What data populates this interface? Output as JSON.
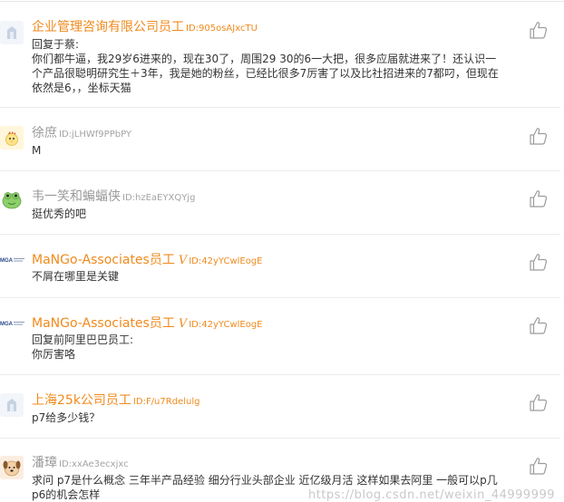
{
  "comments": [
    {
      "name": "企业管理咨询有限公司员工",
      "id_label": "ID:905osAJxcTU",
      "lines": [
        "回复于蔡:",
        "你们都牛逼，我29岁6进来的，现在30了，周围29 30的6一大把，很多应届就进来了！还认识一",
        "个产品很聪明研究生＋3年，我是她的粉丝，已经比很多7厉害了以及比社招进来的7都叼，但现在",
        "依然是6，，坐标天猫"
      ]
    },
    {
      "name": "徐庶",
      "id_label": "ID:jLHWf9PPbPY",
      "lines": [
        "M"
      ]
    },
    {
      "name": "韦一笑和蝙蝠侠",
      "id_label": "ID:hzEaEYXQYjg",
      "lines": [
        "挺优秀的吧"
      ]
    },
    {
      "name": "MaNGo-Associates员工",
      "verified": "V",
      "id_label": "ID:42yYCwlEogE",
      "logo_text": "MGA",
      "lines": [
        "不屑在哪里是关键"
      ]
    },
    {
      "name": "MaNGo-Associates员工",
      "verified": "V",
      "id_label": "ID:42yYCwlEogE",
      "logo_text": "MGA",
      "lines": [
        "回复前阿里巴巴员工:",
        "你厉害咯"
      ]
    },
    {
      "name": "上海25k公司员工",
      "id_label": "ID:F/u7Rdelulg",
      "lines": [
        "p7给多少钱？"
      ]
    },
    {
      "name": "潘璋",
      "id_label": "ID:xxAe3ecxjxc",
      "lines": [
        "求问 p7是什么概念 三年半产品经验 细分行业头部企业 近亿级月活 这样如果去阿里 一般可以p几",
        "p6的机会怎样"
      ]
    }
  ],
  "watermark": "https://blog.csdn.net/weixin_44999999",
  "colors": {
    "company_name": "#f08a1c",
    "anon_name": "#9a9a9a",
    "text": "#333333",
    "divider": "#ececec"
  }
}
